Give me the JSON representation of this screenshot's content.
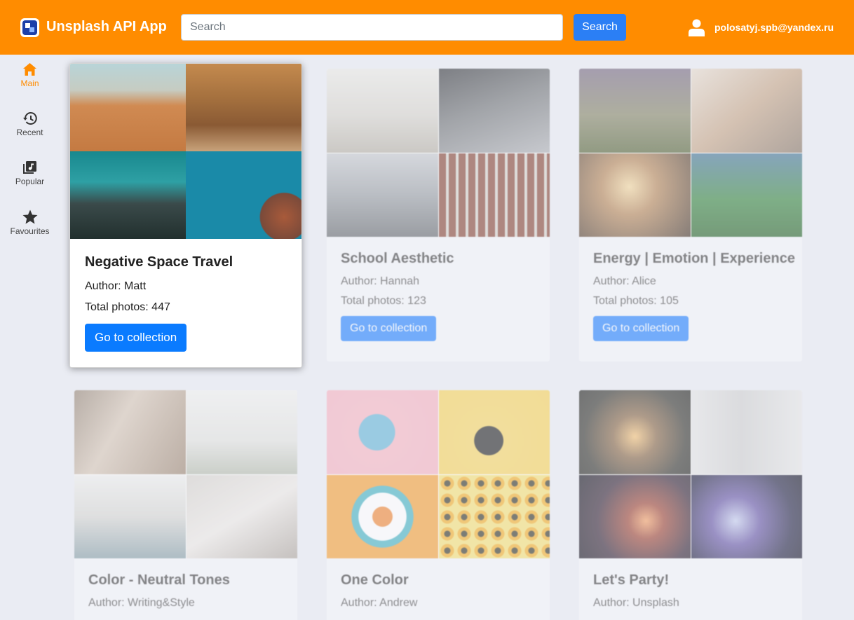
{
  "header": {
    "app_title": "Unsplash API App",
    "search_placeholder": "Search",
    "search_value": "",
    "search_button": "Search",
    "user_email": "polosatyj.spb@yandex.ru",
    "background_color": "#ff8c00"
  },
  "sidebar": {
    "items": [
      {
        "label": "Main",
        "icon": "home-icon",
        "active": true
      },
      {
        "label": "Recent",
        "icon": "history-icon",
        "active": false
      },
      {
        "label": "Popular",
        "icon": "music-library-icon",
        "active": false
      },
      {
        "label": "Favourites",
        "icon": "star-icon",
        "active": false
      }
    ],
    "active_color": "#ff8c00"
  },
  "collections": [
    {
      "title": "Negative Space Travel",
      "author": "Author: Matt",
      "total": "Total photos: 447",
      "button": "Go to collection",
      "focused": true
    },
    {
      "title": "School Aesthetic",
      "author": "Author: Hannah",
      "total": "Total photos: 123",
      "button": "Go to collection"
    },
    {
      "title": "Energy | Emotion | Experience",
      "author": "Author: Alice",
      "total": "Total photos: 105",
      "button": "Go to collection"
    },
    {
      "title": "Color - Neutral Tones",
      "author": "Author: Writing&Style"
    },
    {
      "title": "One Color",
      "author": "Author: Andrew"
    },
    {
      "title": "Let's Party!",
      "author": "Author: Unsplash"
    }
  ]
}
